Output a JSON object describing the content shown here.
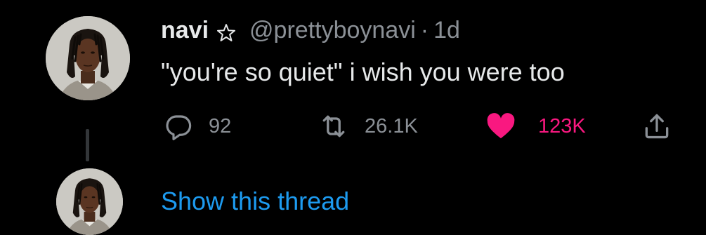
{
  "tweet": {
    "author": {
      "name": "navi",
      "badge_icon": "star-outline-icon",
      "handle": "@prettyboynavi"
    },
    "separator": "·",
    "timestamp": "1d",
    "text": "\"you're so quiet\" i wish you were too",
    "actions": {
      "reply": {
        "icon": "reply-bubble-icon",
        "count": "92"
      },
      "retweet": {
        "icon": "retweet-icon",
        "count": "26.1K"
      },
      "like": {
        "icon": "heart-icon",
        "count": "123K",
        "active": true
      },
      "share": {
        "icon": "share-icon"
      }
    }
  },
  "thread": {
    "show_label": "Show this thread"
  },
  "colors": {
    "background": "#000000",
    "text_primary": "#e7e9ea",
    "text_secondary": "#8b9096",
    "like_active": "#f91880",
    "link": "#1d9bf0",
    "thread_line": "#333639"
  }
}
